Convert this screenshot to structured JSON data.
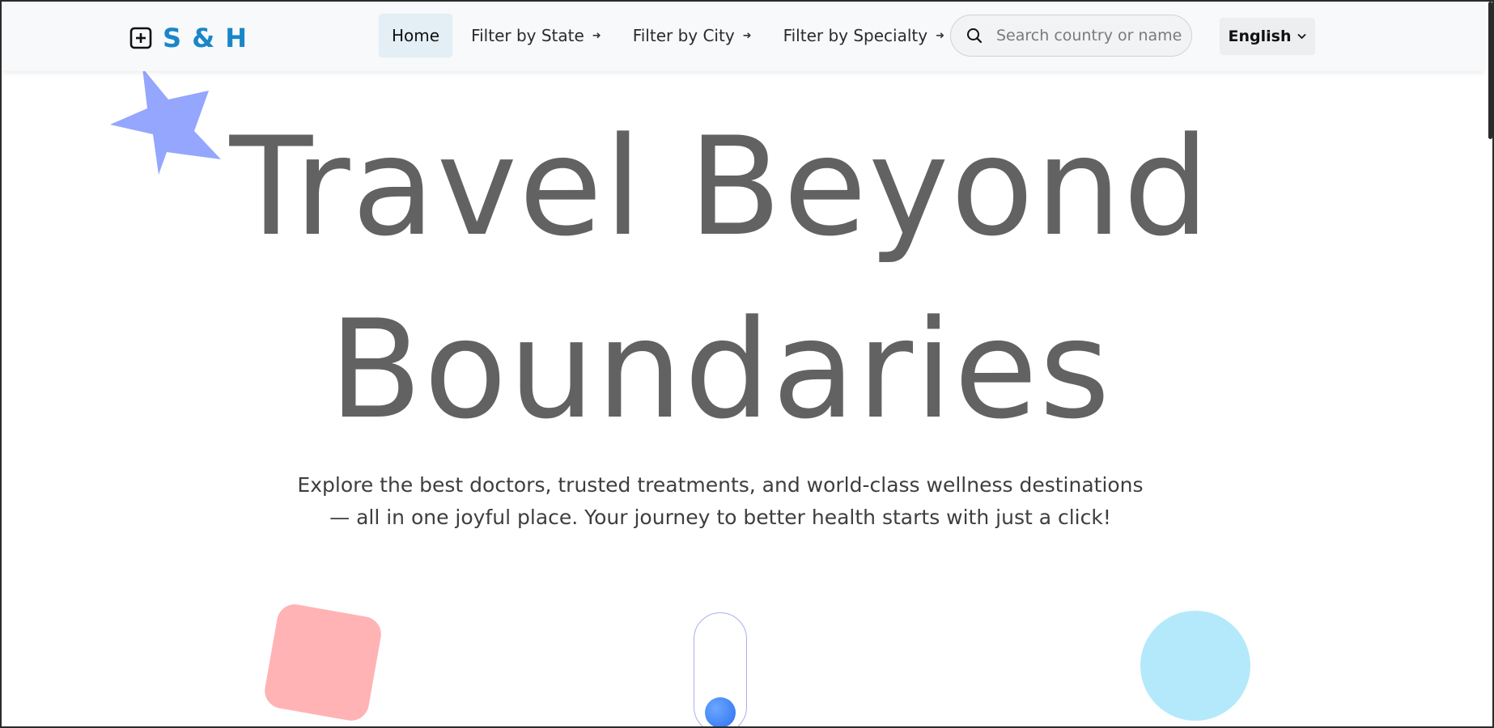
{
  "brand": {
    "name": "S & H",
    "icon": "plus-square-icon",
    "color": "#1a86c8"
  },
  "nav": {
    "items": [
      {
        "label": "Home",
        "active": true
      },
      {
        "label": "Filter by State",
        "arrow": "➜"
      },
      {
        "label": "Filter by City",
        "arrow": "➜"
      },
      {
        "label": "Filter by Specialty",
        "arrow": "➜"
      }
    ]
  },
  "search": {
    "placeholder": "Search country or name",
    "icon": "search-icon"
  },
  "language": {
    "selected": "English",
    "caret": "⌄"
  },
  "hero": {
    "title_line1": "Travel Beyond",
    "title_line2": "Boundaries",
    "subtitle_line1": "Explore the best doctors, trusted treatments, and world-class wellness destinations",
    "subtitle_line2": "— all in one joyful place. Your journey to better health starts with just a click!",
    "title_color": "#626262"
  },
  "decor": {
    "star_color": "#94a6fd",
    "square_color": "#ffb3b5",
    "circle_color": "#b3e9fb",
    "scroll_dot_color": "#2d6ff0"
  }
}
